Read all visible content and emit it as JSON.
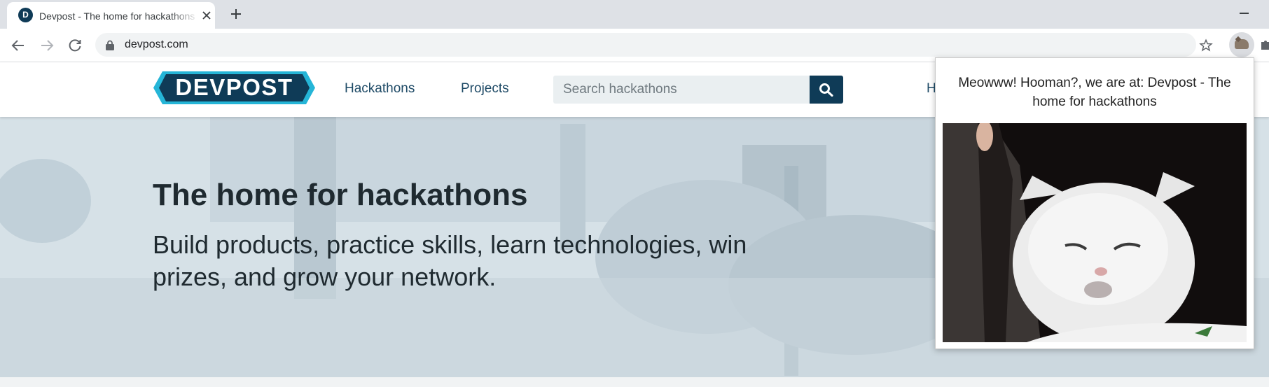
{
  "browser": {
    "tab_title": "Devpost - The home for hackathons",
    "favicon_letter": "D",
    "url": "devpost.com",
    "icons": [
      "close-icon",
      "plus-icon",
      "back-arrow-icon",
      "forward-arrow-icon",
      "reload-icon",
      "lock-icon",
      "star-icon",
      "cat-extension-icon",
      "puzzle-icon"
    ]
  },
  "header": {
    "logo_text": "DEVPOST",
    "nav": [
      "Hackathons",
      "Projects"
    ],
    "search_placeholder": "Search hackathons",
    "partial_link": "H",
    "colors": {
      "brand_dark": "#0f3b57",
      "brand_accent": "#25b5d7"
    }
  },
  "hero": {
    "title": "The home for hackathons",
    "subtitle": "Build products, practice skills, learn technologies, win prizes, and grow your network."
  },
  "popup": {
    "message": "Meowww! Hooman?, we are at: Devpost - The home for hackathons",
    "image_description_icon": "cat-photo"
  }
}
